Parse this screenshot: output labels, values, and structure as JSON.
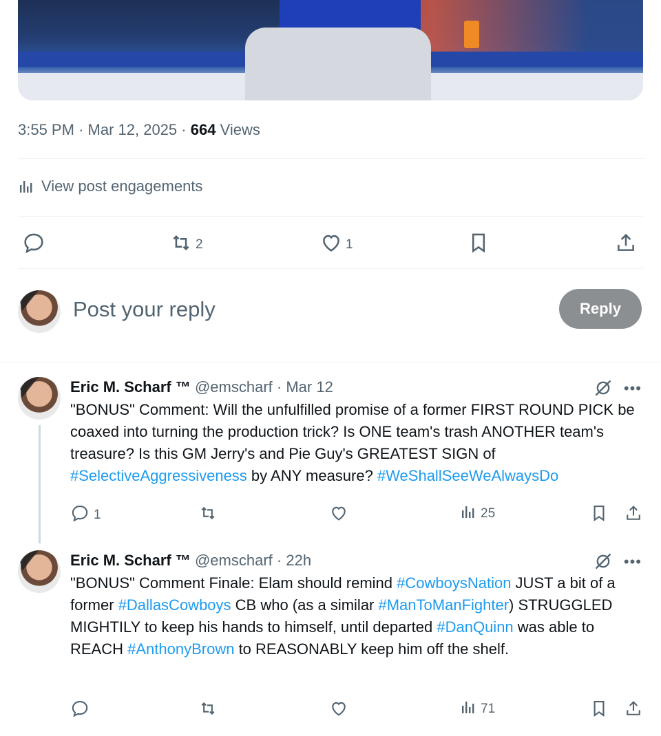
{
  "post": {
    "time": "3:55 PM",
    "date": "Mar 12, 2025",
    "views_count": "664",
    "views_label": "Views",
    "engagements_label": "View post engagements",
    "reposts": "2",
    "likes": "1"
  },
  "reply_box": {
    "placeholder": "Post your reply",
    "button_label": "Reply"
  },
  "replies": [
    {
      "name": "Eric M. Scharf ™",
      "handle": "@emscharf",
      "time": "Mar 12",
      "text_1": "\"BONUS\" Comment: Will the unfulfilled promise of a former FIRST ROUND PICK be coaxed into turning the production trick? Is ONE team's trash ANOTHER team's treasure? Is this GM Jerry's and Pie Guy's GREATEST SIGN of ",
      "tag_1": "#SelectiveAggressiveness",
      "text_2": " by ANY measure? ",
      "tag_2": "#WeShallSeeWeAlwaysDo",
      "reply_count": "1",
      "views": "25"
    },
    {
      "name": "Eric M. Scharf ™",
      "handle": "@emscharf",
      "time": "22h",
      "text_1": "\"BONUS\" Comment Finale: Elam should remind ",
      "tag_1": "#CowboysNation",
      "text_2": " JUST a bit of a former ",
      "tag_2": "#DallasCowboys",
      "text_3": " CB who (as a similar ",
      "tag_3": "#ManToManFighter",
      "text_4": ") STRUGGLED MIGHTILY to keep his hands to himself, until departed ",
      "tag_4": "#DanQuinn",
      "text_5": " was able to REACH ",
      "tag_5": "#AnthonyBrown",
      "text_6": " to REASONABLY keep him off the shelf.",
      "views": "71"
    }
  ],
  "colors": {
    "accent": "#1d9bf0",
    "muted": "#536471",
    "reply_button": "#8b8f92"
  }
}
